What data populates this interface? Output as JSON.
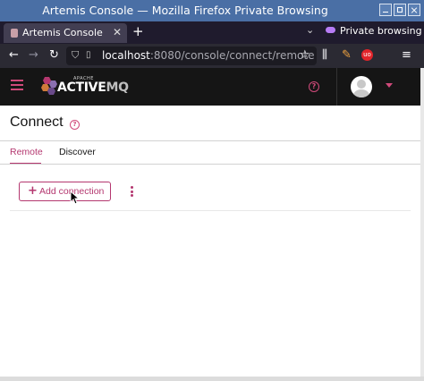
{
  "window": {
    "title": "Artemis Console — Mozilla Firefox Private Browsing"
  },
  "browser": {
    "tab_title": "Artemis Console",
    "private_label": "Private browsing",
    "url_host": "localhost",
    "url_rest": ":8080/console/connect/remote"
  },
  "app": {
    "brand_small": "APACHE",
    "brand_main": "ACTIVE",
    "brand_suffix": "MQ"
  },
  "page": {
    "title": "Connect",
    "tabs": [
      {
        "label": "Remote",
        "active": true
      },
      {
        "label": "Discover",
        "active": false
      }
    ],
    "add_button_label": "Add connection"
  },
  "colors": {
    "accent": "#b4376f",
    "masthead": "#151515",
    "browser_chrome": "#2b2a33",
    "titlebar": "#4a6fa5"
  }
}
